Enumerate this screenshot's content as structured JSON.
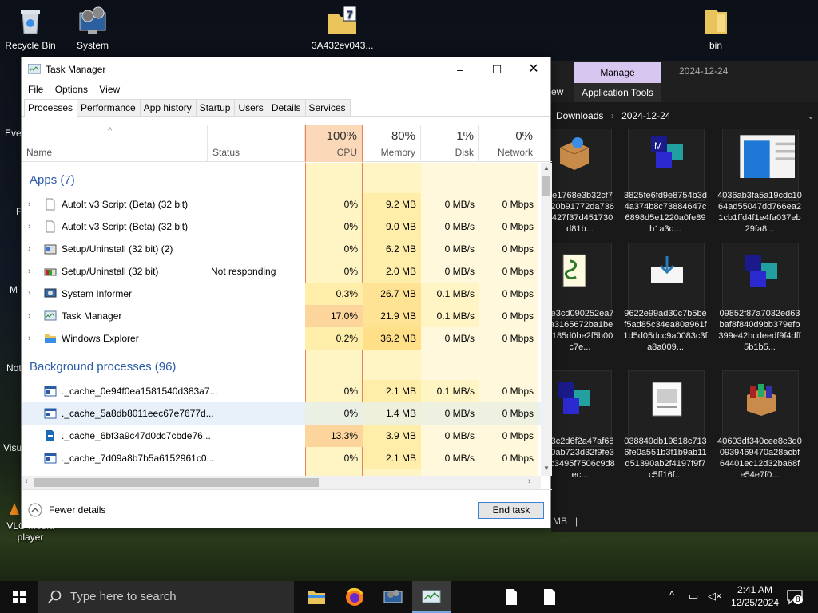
{
  "desktop": {
    "icons": [
      {
        "label": "Recycle Bin",
        "icon": "recycle-bin-icon"
      },
      {
        "label": "System",
        "icon": "system-gear-icon"
      },
      {
        "label": "3A432ev043...",
        "icon": "archive-folder-icon"
      },
      {
        "label": "bin",
        "icon": "folder-icon"
      }
    ],
    "partial_labels": [
      "Eve",
      "F",
      "M",
      "Not",
      "Visu",
      "VLC media player"
    ]
  },
  "explorer": {
    "manage_label": "Manage",
    "date_tab": "2024-12-24",
    "view_tab": "ew",
    "app_tools": "Application Tools",
    "breadcrumb": [
      "Downloads",
      "2024-12-24"
    ],
    "status_text": "MB",
    "tiles": [
      {
        "label": "6e1768e3b32cf7720b91772da736b427f37d451730d81b...",
        "icon": "package-icon"
      },
      {
        "label": "3825fe6fd9e8754b3d4a374b8c73884647c6898d5e1220a0fe89b1a3d...",
        "icon": "mfc-icon"
      },
      {
        "label": "4036ab3fa5a19cdc1064ad55047dd766ea21cb1ffd4f1e4fa037eb29fa8...",
        "icon": "document-preview-icon"
      },
      {
        "label": "6e3cd090252ea7fa3165672ba1bee185d0be2f5b00c7e...",
        "icon": "script-icon"
      },
      {
        "label": "9622e99ad30c7b5bef5ad85c34ea80a961f1d5d05dcc9a0083c3fa8a009...",
        "icon": "download-icon"
      },
      {
        "label": "09852f87a7032ed63baf8f840d9bb379efb399e42bcdeedf9f4dff5b1b5...",
        "icon": "mfc-icon"
      },
      {
        "label": "03c2d6f2a47af6880ab723d32f9fe33c3495f7506c9d8ec...",
        "icon": "mfc-icon"
      },
      {
        "label": "038849db19818c7136fe0a551b3f1b9ab11d51390ab2f4197f9f7c5ff16f...",
        "icon": "image-doc-icon"
      },
      {
        "label": "40603df340cee8c3d00939469470a28acbf64401ec12d32ba68fe54e7f0...",
        "icon": "winrar-icon"
      }
    ]
  },
  "taskmanager": {
    "title": "Task Manager",
    "menu": [
      "File",
      "Options",
      "View"
    ],
    "tabs": [
      "Processes",
      "Performance",
      "App history",
      "Startup",
      "Users",
      "Details",
      "Services"
    ],
    "columns": {
      "name": "Name",
      "status": "Status",
      "cpu": {
        "pct": "100%",
        "label": "CPU"
      },
      "memory": {
        "pct": "80%",
        "label": "Memory"
      },
      "disk": {
        "pct": "1%",
        "label": "Disk"
      },
      "network": {
        "pct": "0%",
        "label": "Network"
      }
    },
    "apps_header": "Apps (7)",
    "bg_header": "Background processes (96)",
    "apps": [
      {
        "name": "AutoIt v3 Script (Beta) (32 bit)",
        "status": "",
        "cpu": "0%",
        "mem": "9.2 MB",
        "disk": "0 MB/s",
        "net": "0 Mbps"
      },
      {
        "name": "AutoIt v3 Script (Beta) (32 bit)",
        "status": "",
        "cpu": "0%",
        "mem": "9.0 MB",
        "disk": "0 MB/s",
        "net": "0 Mbps"
      },
      {
        "name": "Setup/Uninstall (32 bit) (2)",
        "status": "",
        "cpu": "0%",
        "mem": "6.2 MB",
        "disk": "0 MB/s",
        "net": "0 Mbps"
      },
      {
        "name": "Setup/Uninstall (32 bit)",
        "status": "Not responding",
        "cpu": "0%",
        "mem": "2.0 MB",
        "disk": "0 MB/s",
        "net": "0 Mbps"
      },
      {
        "name": "System Informer",
        "status": "",
        "cpu": "0.3%",
        "mem": "26.7 MB",
        "disk": "0.1 MB/s",
        "net": "0 Mbps"
      },
      {
        "name": "Task Manager",
        "status": "",
        "cpu": "17.0%",
        "mem": "21.9 MB",
        "disk": "0.1 MB/s",
        "net": "0 Mbps"
      },
      {
        "name": "Windows Explorer",
        "status": "",
        "cpu": "0.2%",
        "mem": "36.2 MB",
        "disk": "0 MB/s",
        "net": "0 Mbps"
      }
    ],
    "background": [
      {
        "name": "._cache_0e94f0ea1581540d383a7...",
        "cpu": "0%",
        "mem": "2.1 MB",
        "disk": "0.1 MB/s",
        "net": "0 Mbps"
      },
      {
        "name": "._cache_5a8db8011eec67e7677d...",
        "cpu": "0%",
        "mem": "1.4 MB",
        "disk": "0 MB/s",
        "net": "0 Mbps"
      },
      {
        "name": "._cache_6bf3a9c47d0dc7cbde76...",
        "cpu": "13.3%",
        "mem": "3.9 MB",
        "disk": "0 MB/s",
        "net": "0 Mbps"
      },
      {
        "name": "._cache_7d09a8b7b5a6152961c0...",
        "cpu": "0%",
        "mem": "2.1 MB",
        "disk": "0 MB/s",
        "net": "0 Mbps"
      }
    ],
    "fewer_details": "Fewer details",
    "end_task": "End task"
  },
  "taskbar": {
    "search_placeholder": "Type here to search",
    "time": "2:41 AM",
    "date": "12/25/2024",
    "notification_count": "8"
  },
  "colors": {
    "accent": "#2a5ca8",
    "cpu_high": "#fde2b0",
    "heat_low": "#fff4c4",
    "selected": "#e8f0fa"
  }
}
